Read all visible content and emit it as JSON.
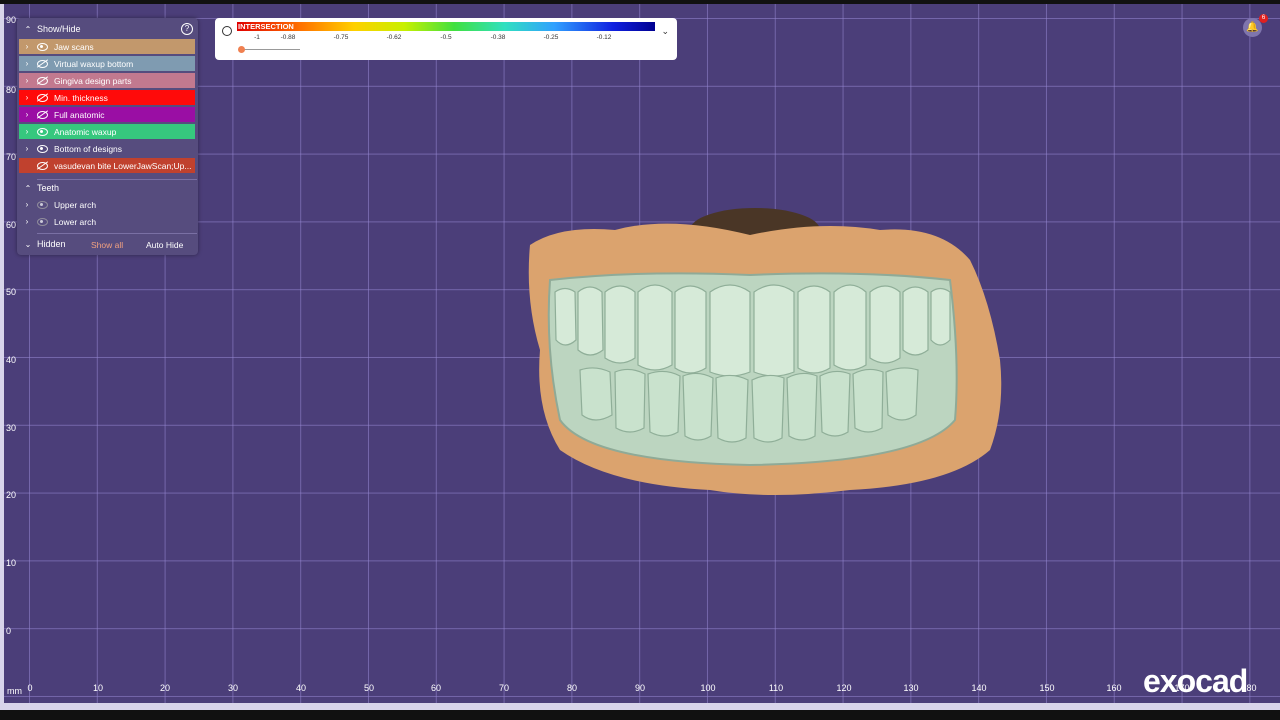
{
  "panel": {
    "title": "Show/Hide",
    "layers": [
      {
        "label": "Jaw scans",
        "color": "#c2986c",
        "visible": true
      },
      {
        "label": "Virtual waxup bottom",
        "color": "#7f9bb1",
        "visible": false
      },
      {
        "label": "Gingiva design parts",
        "color": "#c2798f",
        "visible": false
      },
      {
        "label": "Min. thickness",
        "color": "#ff0a0a",
        "visible": false
      },
      {
        "label": "Full anatomic",
        "color": "#9a0ea4",
        "visible": false
      },
      {
        "label": "Anatomic waxup",
        "color": "#36c77e",
        "visible": true
      },
      {
        "label": "Bottom of designs",
        "color": "#564c7e",
        "visible": true
      },
      {
        "label": "vasudevan bite LowerJawScan;Up...",
        "color": "#c0412e",
        "visible": false
      }
    ],
    "teeth_title": "Teeth",
    "teeth": [
      {
        "label": "Upper arch"
      },
      {
        "label": "Lower arch"
      }
    ],
    "hidden_label": "Hidden",
    "show_all": "Show all",
    "auto_hide": "Auto Hide"
  },
  "colorbar": {
    "label": "INTERSECTION",
    "ticks": [
      "-1",
      "-0.88",
      "-0.75",
      "-0.62",
      "-0.5",
      "-0.38",
      "-0.25",
      "-0.12"
    ],
    "slider_value": -1
  },
  "notifications": {
    "count": "6",
    "icon": "bell-icon"
  },
  "axis": {
    "unit": "mm",
    "x_ticks": [
      "0",
      "10",
      "20",
      "30",
      "40",
      "50",
      "60",
      "70",
      "80",
      "90",
      "100",
      "110",
      "120",
      "130",
      "140",
      "150",
      "160",
      "170",
      "180"
    ],
    "y_ticks": [
      "90",
      "80",
      "70",
      "60",
      "50",
      "40",
      "30",
      "20",
      "10",
      "0"
    ]
  },
  "brand": {
    "logo": "exocad"
  }
}
